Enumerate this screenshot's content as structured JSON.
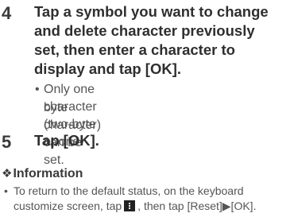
{
  "step4": {
    "number": "4",
    "lines": [
      "Tap a symbol you want to change",
      "and delete character previously",
      "set, then enter a character to",
      "display and tap [OK]."
    ],
    "bullet_lines": [
      "Only one character (two-byte or one-",
      "byte character) can be set."
    ]
  },
  "step5": {
    "number": "5",
    "title": "Tap [OK]."
  },
  "information": {
    "heading": "Information",
    "text_before_icon": "customize screen, tap",
    "text_after_icon": ", then tap [Reset]▶[OK].",
    "first_line": "To return to the default status, on the keyboard",
    "icon": "menu-icon"
  }
}
